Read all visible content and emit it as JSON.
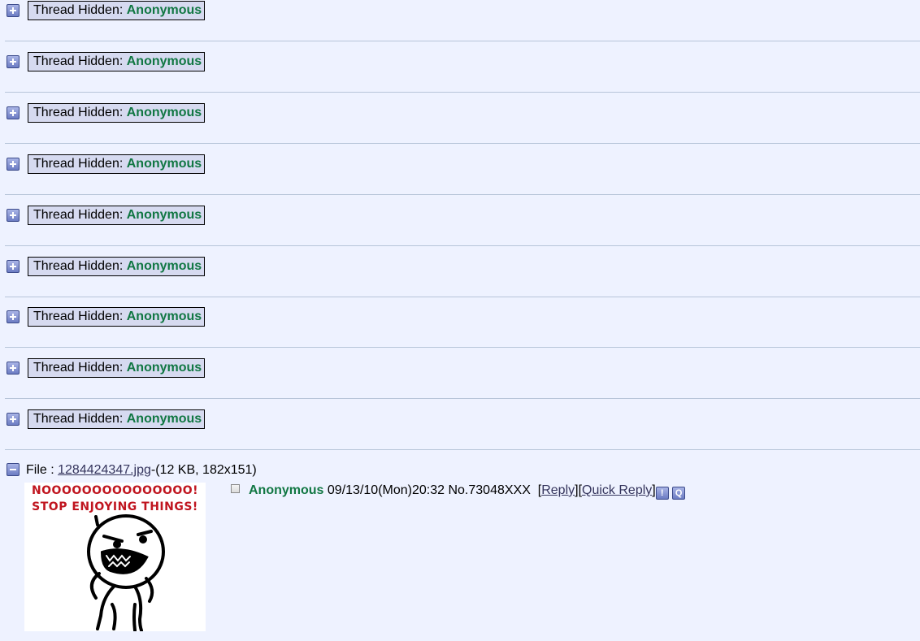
{
  "hidden_threads": [
    {
      "label": "Thread Hidden:",
      "name": "Anonymous"
    },
    {
      "label": "Thread Hidden:",
      "name": "Anonymous"
    },
    {
      "label": "Thread Hidden:",
      "name": "Anonymous"
    },
    {
      "label": "Thread Hidden:",
      "name": "Anonymous"
    },
    {
      "label": "Thread Hidden:",
      "name": "Anonymous"
    },
    {
      "label": "Thread Hidden:",
      "name": "Anonymous"
    },
    {
      "label": "Thread Hidden:",
      "name": "Anonymous"
    },
    {
      "label": "Thread Hidden:",
      "name": "Anonymous"
    },
    {
      "label": "Thread Hidden:",
      "name": "Anonymous"
    }
  ],
  "thread": {
    "file_label": "File :",
    "file_name": "1284424347.jpg",
    "file_info": "-(12 KB, 182x151)",
    "image_caption_line1": "NOOOOOOOOOOOOOOO!",
    "image_caption_line2": "STOP ENJOYING THINGS!",
    "poster_name": "Anonymous",
    "date": "09/13/10(Mon)20:32",
    "post_number": "No.73048XXX",
    "reply_label": "Reply",
    "quick_reply_label": "Quick Reply",
    "report_icon_glyph": "!",
    "quote_icon_glyph": "Q"
  },
  "icons": {
    "expand": "plus-icon",
    "collapse": "minus-icon",
    "report": "report-icon",
    "quote": "quote-icon"
  },
  "colors": {
    "background": "#eef2ff",
    "name": "#117743",
    "hidden_box": "#d6daf0",
    "link": "#34345c",
    "caption": "#c0151f"
  }
}
